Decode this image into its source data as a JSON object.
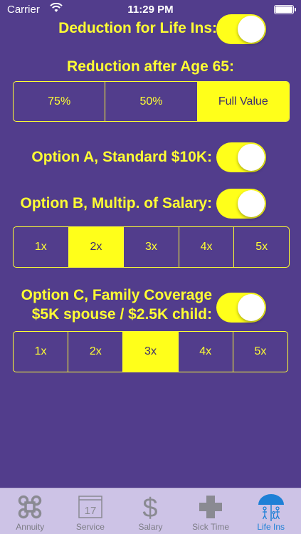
{
  "status_bar": {
    "carrier": "Carrier",
    "time": "11:29 PM"
  },
  "deduction": {
    "label": "Deduction for Life Ins:",
    "on": true
  },
  "reduction": {
    "label": "Reduction after Age 65:",
    "options": [
      "75%",
      "50%",
      "Full Value"
    ],
    "selected": "Full Value"
  },
  "option_a": {
    "label": "Option A, Standard $10K:",
    "on": true
  },
  "option_b": {
    "label": "Option B, Multip. of Salary:",
    "on": true,
    "options": [
      "1x",
      "2x",
      "3x",
      "4x",
      "5x"
    ],
    "selected": "2x"
  },
  "option_c": {
    "label_line1": "Option C, Family Coverage",
    "label_line2": "$5K spouse / $2.5K child:",
    "on": true,
    "options": [
      "1x",
      "2x",
      "3x",
      "4x",
      "5x"
    ],
    "selected": "3x"
  },
  "tabs": [
    {
      "label": "Annuity",
      "icon": "command-icon",
      "active": false
    },
    {
      "label": "Service",
      "icon": "calendar-icon",
      "active": false,
      "icon_text": "17"
    },
    {
      "label": "Salary",
      "icon": "dollar-icon",
      "active": false,
      "icon_text": "$"
    },
    {
      "label": "Sick Time",
      "icon": "plus-cross-icon",
      "active": false
    },
    {
      "label": "Life Ins",
      "icon": "umbrella-family-icon",
      "active": true
    }
  ],
  "colors": {
    "background": "#523d8c",
    "accent": "#ffff1a",
    "tab_bar": "#cdc3e6",
    "tab_active": "#1e80d6",
    "tab_inactive": "#7d7d86"
  }
}
